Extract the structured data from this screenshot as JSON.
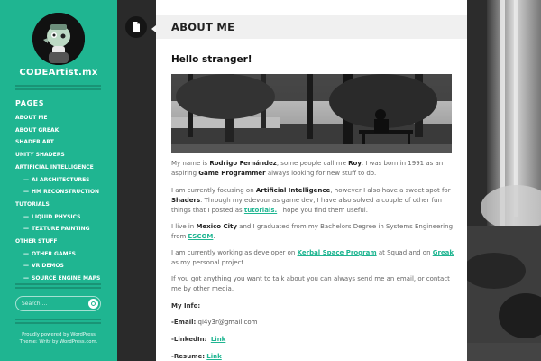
{
  "site": {
    "title": "CODEArtist.mx",
    "pages_heading": "PAGES",
    "search_placeholder": "Search ...",
    "footer_line1": "Proudly powered by WordPress",
    "footer_line2": "Theme: Writr by WordPress.com."
  },
  "menu": [
    {
      "label": "ABOUT ME",
      "level": 0
    },
    {
      "label": "ABOUT GREAK",
      "level": 0
    },
    {
      "label": "SHADER ART",
      "level": 0
    },
    {
      "label": "UNITY SHADERS",
      "level": 0
    },
    {
      "label": "ARTIFICIAL INTELLIGENCE",
      "level": 0
    },
    {
      "label": "AI ARCHITECTURES",
      "level": 1
    },
    {
      "label": "HM RECONSTRUCTION",
      "level": 1
    },
    {
      "label": "TUTORIALS",
      "level": 0
    },
    {
      "label": "LIQUID PHYSICS",
      "level": 1
    },
    {
      "label": "TEXTURE PAINTING",
      "level": 1
    },
    {
      "label": "OTHER STUFF",
      "level": 0
    },
    {
      "label": "OTHER GAMES",
      "level": 1
    },
    {
      "label": "VR DEMOS",
      "level": 1
    },
    {
      "label": "SOURCE ENGINE MAPS",
      "level": 1
    }
  ],
  "post": {
    "title": "ABOUT ME",
    "greeting": "Hello stranger!",
    "p1": {
      "t1": "My  name is ",
      "name": "Rodrigo Fernández",
      "t2": ", some people call me ",
      "nick": "Roy",
      "t3": ". I was born in 1991 as an aspiring ",
      "role": "Game Programmer",
      "t4": " always looking for new stuff to do."
    },
    "p2": {
      "t1": "I am currently focusing on ",
      "ai": "Artificial Intelligence",
      "t2": ", however I also have a sweet spot for ",
      "shaders": "Shaders",
      "t3": ". Through my edevour as game dev, I have also solved a couple of other fun things that I posted as ",
      "tutorials_link": "tutorials.",
      "t4": " I hope you find them useful."
    },
    "p3": {
      "t1": "I live in ",
      "city": "Mexico City",
      "t2": " and I graduated from my Bachelors Degree in Systems Engineering from ",
      "escom_link": "ESCOM",
      "t3": "."
    },
    "p4": {
      "t1": "I am currently working as developer on ",
      "ksp_link": "Kerbal Space Program",
      "t2": " at Squad and on ",
      "greak_link": "Greak",
      "t3": " as my personal project."
    },
    "p5": "If you got anything you want to talk about  you can always send me an email, or contact me by other media.",
    "info_heading": "My Info:",
    "email_label": "-Email:",
    "email_value": "qi4y3r@gmail.com",
    "linkedin_label": "-LinkedIn:",
    "linkedin_link": "Link",
    "resume_label": "-Resume:",
    "resume_link": "Link"
  },
  "colors": {
    "accent": "#1fb591",
    "dark_strip": "#2a2a2a"
  },
  "icons": {
    "page_toggle": "page-icon"
  }
}
